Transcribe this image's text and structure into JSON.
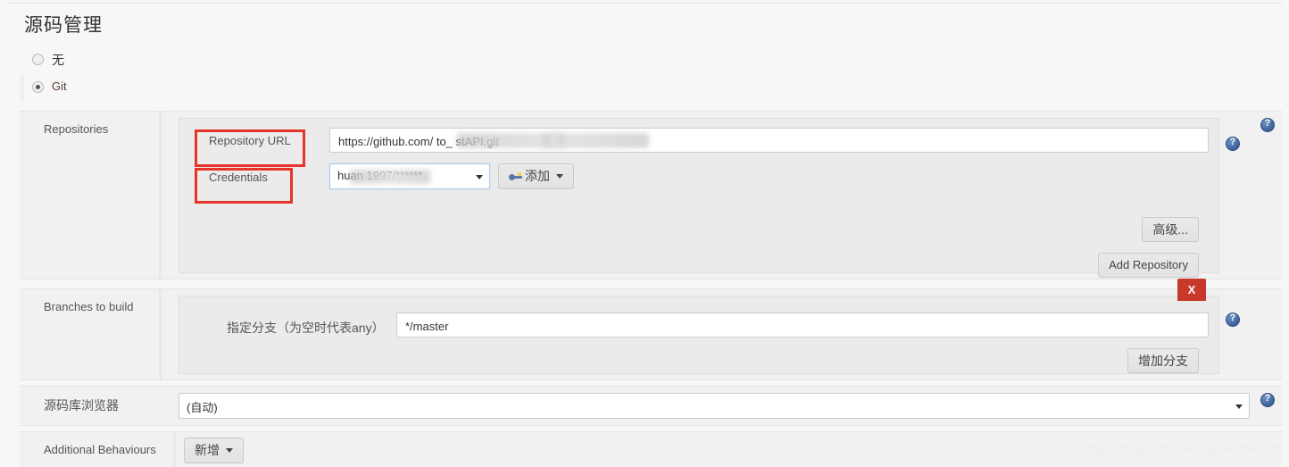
{
  "page": {
    "title": "源码管理",
    "watermark": "https://blog.csdn.net/qq_42098424"
  },
  "scm_radio": {
    "options": [
      {
        "label": "无",
        "selected": false
      },
      {
        "label": "Git",
        "selected": true
      }
    ]
  },
  "repositories": {
    "label": "Repositories",
    "repository_url": {
      "label": "Repository URL",
      "value": "https://github.com/                  to_   stAPI.git",
      "value_visible_prefix": "https://github.com/",
      "value_visible_suffix": "to_   stAPI.git",
      "redacted": true
    },
    "credentials": {
      "label": "Credentials",
      "selected": "huan                1997/******",
      "redacted": true
    },
    "add_credentials_button": {
      "label": "添加",
      "icon": "key-icon",
      "has_dropdown": true
    },
    "advanced_button": {
      "label": "高级..."
    },
    "add_repository_button": {
      "label": "Add Repository"
    },
    "help_icon": "help-icon"
  },
  "branches": {
    "label": "Branches to build",
    "branch_spec": {
      "label": "指定分支（为空时代表any）",
      "value": "*/master"
    },
    "delete_button": {
      "label": "X"
    },
    "add_branch_button": {
      "label": "增加分支"
    },
    "help_icon": "help-icon"
  },
  "repository_browser": {
    "label": "源码库浏览器",
    "selected": "(自动)",
    "help_icon": "help-icon"
  },
  "additional_behaviours": {
    "label": "Additional Behaviours",
    "add_button": {
      "label": "新增",
      "has_dropdown": true
    }
  },
  "annotations": {
    "boxes": [
      {
        "target": "repository-url-label"
      },
      {
        "target": "credentials-label"
      }
    ],
    "color": "#e8332a"
  }
}
